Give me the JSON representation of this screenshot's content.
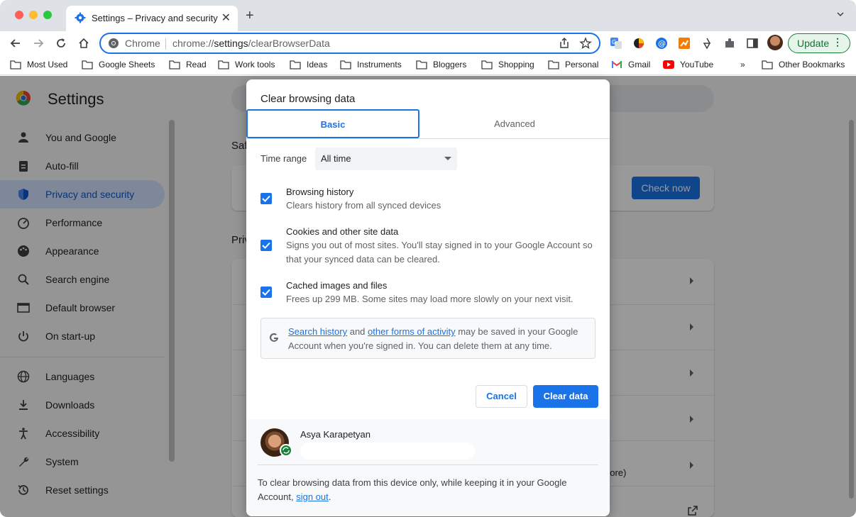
{
  "browser": {
    "tab_title": "Settings – Privacy and security",
    "omnibox_prefix": "Chrome",
    "url_scheme": "chrome://",
    "url_host": "settings",
    "url_path": "/clearBrowserData",
    "update_label": "Update",
    "update_menu": "⋮",
    "accent": "#1a73e8"
  },
  "bookmarks": {
    "items": [
      "Most Used",
      "Google Sheets",
      "Read",
      "Work tools",
      "Ideas",
      "Instruments",
      "Bloggers",
      "Shopping",
      "Personal",
      "Gmail",
      "YouTube"
    ],
    "overflow": "»",
    "other": "Other Bookmarks"
  },
  "settings": {
    "title": "Settings",
    "sidebar": [
      {
        "label": "You and Google",
        "icon": "person-icon"
      },
      {
        "label": "Auto-fill",
        "icon": "clipboard-icon"
      },
      {
        "label": "Privacy and security",
        "icon": "shield-icon"
      },
      {
        "label": "Performance",
        "icon": "speedometer-icon"
      },
      {
        "label": "Appearance",
        "icon": "palette-icon"
      },
      {
        "label": "Search engine",
        "icon": "search-icon"
      },
      {
        "label": "Default browser",
        "icon": "browser-icon"
      },
      {
        "label": "On start-up",
        "icon": "power-icon"
      },
      {
        "label": "Languages",
        "icon": "globe-icon"
      },
      {
        "label": "Downloads",
        "icon": "download-icon"
      },
      {
        "label": "Accessibility",
        "icon": "accessibility-icon"
      },
      {
        "label": "System",
        "icon": "wrench-icon"
      },
      {
        "label": "Reset settings",
        "icon": "history-icon"
      }
    ],
    "active_item": "Privacy and security",
    "safety_head": "Saf",
    "privacy_head": "Priv",
    "check_now": "Check now",
    "more_fragment": "nore)"
  },
  "dialog": {
    "title": "Clear browsing data",
    "tabs": {
      "basic": "Basic",
      "advanced": "Advanced"
    },
    "time_range_label": "Time range",
    "time_range_value": "All time",
    "options": [
      {
        "title": "Browsing history",
        "desc": "Clears history from all synced devices",
        "checked": true
      },
      {
        "title": "Cookies and other site data",
        "desc": "Signs you out of most sites. You'll stay signed in to your Google Account so that your synced data can be cleared.",
        "checked": true
      },
      {
        "title": "Cached images and files",
        "desc": "Frees up 299 MB. Some sites may load more slowly on your next visit.",
        "checked": true
      }
    ],
    "notice": {
      "link1": "Search history",
      "and": "and",
      "link2": "other forms of activity",
      "rest": "may be saved in your Google Account when you're signed in. You can delete them at any time."
    },
    "cancel": "Cancel",
    "clear": "Clear data",
    "account_name": "Asya Karapetyan",
    "footer_text": "To clear browsing data from this device only, while keeping it in your Google Account,",
    "footer_link": "sign out",
    "footer_end": "."
  }
}
